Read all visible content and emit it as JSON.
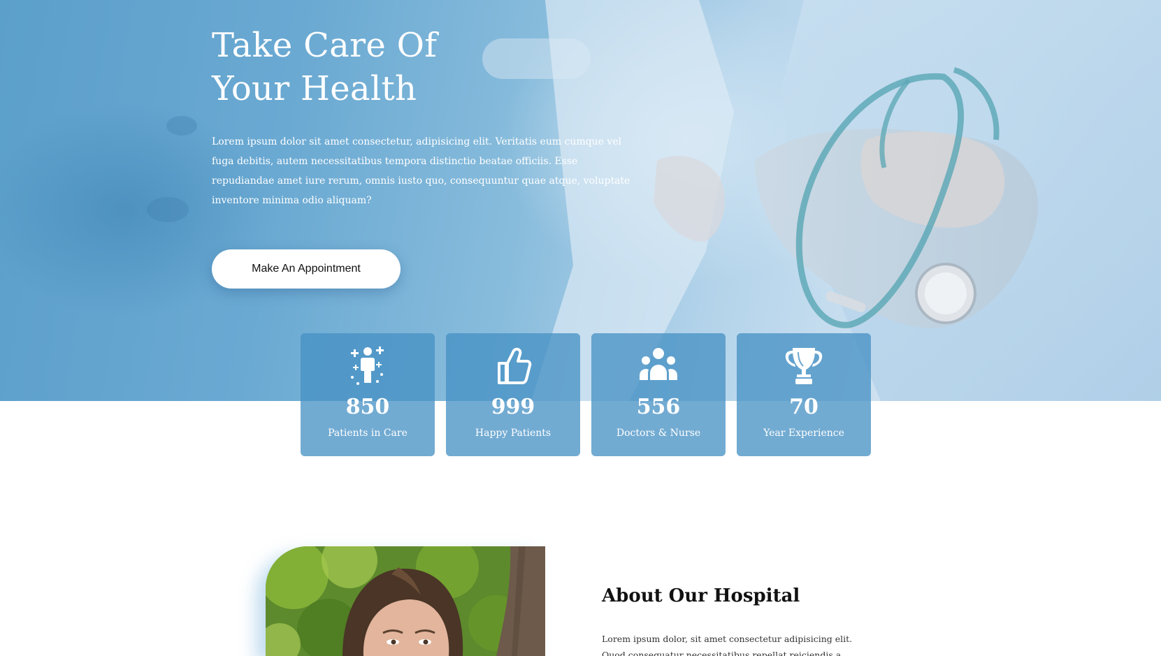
{
  "hero": {
    "title_line1": "Take Care Of",
    "title_line2": "Your Health",
    "description": "Lorem ipsum dolor sit amet consectetur, adipisicing elit. Veritatis eum cumque vel fuga debitis, autem necessitatibus tempora distinctio beatae officiis. Esse repudiandae amet iure rerum, omnis iusto quo, consequuntur quae atque, voluptate inventore minima odio aliquam?",
    "button_label": "Make An Appointment"
  },
  "stats": [
    {
      "icon": "patient-icon",
      "value": "850",
      "label": "Patients in Care"
    },
    {
      "icon": "thumbs-up-icon",
      "value": "999",
      "label": "Happy Patients"
    },
    {
      "icon": "people-group-icon",
      "value": "556",
      "label": "Doctors & Nurse"
    },
    {
      "icon": "trophy-icon",
      "value": "70",
      "label": "Year Experience"
    }
  ],
  "about": {
    "title": "About Our Hospital",
    "text": "Lorem ipsum dolor, sit amet consectetur adipisicing elit. Quod consequatur necessitatibus repellat reiciendis a molestiae sit!"
  },
  "colors": {
    "stat_card": "#4691c4",
    "accent": "#5b9fcb"
  }
}
